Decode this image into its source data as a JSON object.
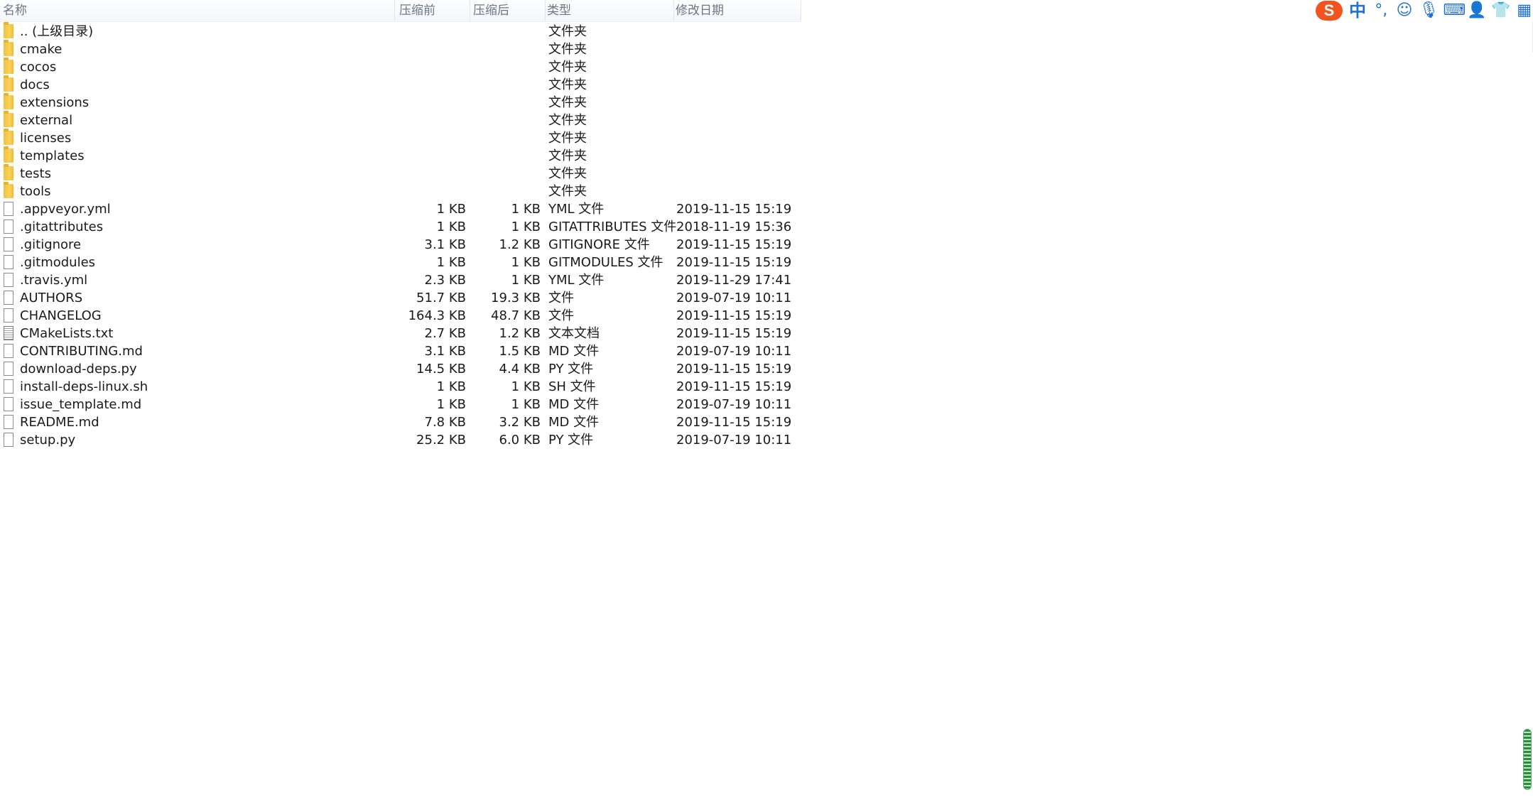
{
  "columns": {
    "name": "名称",
    "before": "压缩前",
    "after": "压缩后",
    "type": "类型",
    "date": "修改日期"
  },
  "rows": [
    {
      "kind": "folder",
      "name": ".. (上级目录)",
      "before": "",
      "after": "",
      "type": "文件夹",
      "date": ""
    },
    {
      "kind": "folder",
      "name": "cmake",
      "before": "",
      "after": "",
      "type": "文件夹",
      "date": ""
    },
    {
      "kind": "folder",
      "name": "cocos",
      "before": "",
      "after": "",
      "type": "文件夹",
      "date": ""
    },
    {
      "kind": "folder",
      "name": "docs",
      "before": "",
      "after": "",
      "type": "文件夹",
      "date": ""
    },
    {
      "kind": "folder",
      "name": "extensions",
      "before": "",
      "after": "",
      "type": "文件夹",
      "date": ""
    },
    {
      "kind": "folder",
      "name": "external",
      "before": "",
      "after": "",
      "type": "文件夹",
      "date": ""
    },
    {
      "kind": "folder",
      "name": "licenses",
      "before": "",
      "after": "",
      "type": "文件夹",
      "date": ""
    },
    {
      "kind": "folder",
      "name": "templates",
      "before": "",
      "after": "",
      "type": "文件夹",
      "date": ""
    },
    {
      "kind": "folder",
      "name": "tests",
      "before": "",
      "after": "",
      "type": "文件夹",
      "date": ""
    },
    {
      "kind": "folder",
      "name": "tools",
      "before": "",
      "after": "",
      "type": "文件夹",
      "date": ""
    },
    {
      "kind": "file",
      "name": ".appveyor.yml",
      "before": "1 KB",
      "after": "1 KB",
      "type": "YML 文件",
      "date": "2019-11-15 15:19"
    },
    {
      "kind": "file",
      "name": ".gitattributes",
      "before": "1 KB",
      "after": "1 KB",
      "type": "GITATTRIBUTES 文件",
      "date": "2018-11-19 15:36"
    },
    {
      "kind": "file",
      "name": ".gitignore",
      "before": "3.1 KB",
      "after": "1.2 KB",
      "type": "GITIGNORE 文件",
      "date": "2019-11-15 15:19"
    },
    {
      "kind": "file",
      "name": ".gitmodules",
      "before": "1 KB",
      "after": "1 KB",
      "type": "GITMODULES 文件",
      "date": "2019-11-15 15:19"
    },
    {
      "kind": "file",
      "name": ".travis.yml",
      "before": "2.3 KB",
      "after": "1 KB",
      "type": "YML 文件",
      "date": "2019-11-29 17:41"
    },
    {
      "kind": "file",
      "name": "AUTHORS",
      "before": "51.7 KB",
      "after": "19.3 KB",
      "type": "文件",
      "date": "2019-07-19 10:11"
    },
    {
      "kind": "file",
      "name": "CHANGELOG",
      "before": "164.3 KB",
      "after": "48.7 KB",
      "type": "文件",
      "date": "2019-11-15 15:19"
    },
    {
      "kind": "text",
      "name": "CMakeLists.txt",
      "before": "2.7 KB",
      "after": "1.2 KB",
      "type": "文本文档",
      "date": "2019-11-15 15:19"
    },
    {
      "kind": "file",
      "name": "CONTRIBUTING.md",
      "before": "3.1 KB",
      "after": "1.5 KB",
      "type": "MD 文件",
      "date": "2019-07-19 10:11"
    },
    {
      "kind": "file",
      "name": "download-deps.py",
      "before": "14.5 KB",
      "after": "4.4 KB",
      "type": "PY 文件",
      "date": "2019-11-15 15:19"
    },
    {
      "kind": "file",
      "name": "install-deps-linux.sh",
      "before": "1 KB",
      "after": "1 KB",
      "type": "SH 文件",
      "date": "2019-11-15 15:19"
    },
    {
      "kind": "file",
      "name": "issue_template.md",
      "before": "1 KB",
      "after": "1 KB",
      "type": "MD 文件",
      "date": "2019-07-19 10:11"
    },
    {
      "kind": "file",
      "name": "README.md",
      "before": "7.8 KB",
      "after": "3.2 KB",
      "type": "MD 文件",
      "date": "2019-11-15 15:19"
    },
    {
      "kind": "file",
      "name": "setup.py",
      "before": "25.2 KB",
      "after": "6.0 KB",
      "type": "PY 文件",
      "date": "2019-07-19 10:11"
    }
  ],
  "ime": {
    "logo": "S",
    "mode": "中",
    "punct": "°,",
    "icons": [
      "emoji-icon",
      "microphone-icon",
      "keyboard-icon",
      "user-icon",
      "skin-icon",
      "toolbox-icon"
    ]
  }
}
